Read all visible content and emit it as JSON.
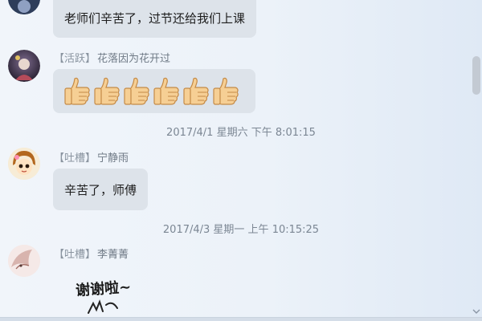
{
  "messages": [
    {
      "name_prefix": "",
      "name": "",
      "text": "老师们辛苦了，过节还给我们上课"
    },
    {
      "name_prefix": "【活跃】",
      "name": "花落因为花开过",
      "thumbs_count": 6
    },
    {
      "timestamp": "2017/4/1 星期六 下午 8:01:15"
    },
    {
      "name_prefix": "【吐槽】",
      "name": "宁静雨",
      "text": "辛苦了，师傅"
    },
    {
      "timestamp": "2017/4/3 星期一 上午 10:15:25"
    },
    {
      "name_prefix": "【吐槽】",
      "name": "李菁菁",
      "sticker_text": "谢谢啦~"
    }
  ],
  "icons": {
    "thumbs": "thumbs-up-emoji",
    "scroll_down": "chevron-down-icon"
  },
  "colors": {
    "bubble": "#dde3ea",
    "timestamp": "#7b8693",
    "name": "#6f7a86"
  }
}
